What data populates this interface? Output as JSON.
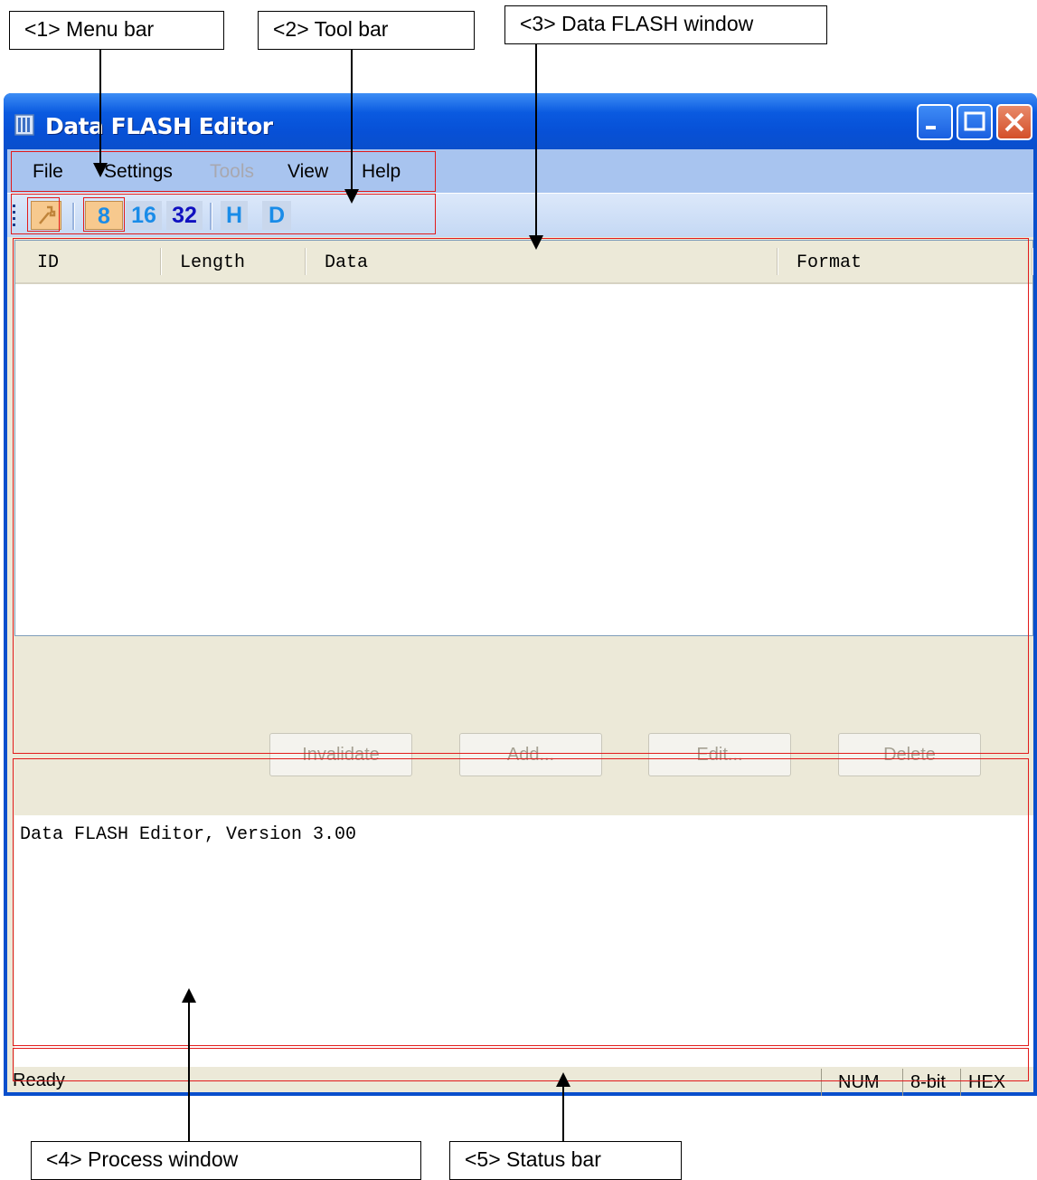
{
  "callouts": {
    "menu_bar": "<1> Menu bar",
    "tool_bar": "<2> Tool bar",
    "data_flash_window": "<3> Data FLASH window",
    "process_window": "<4> Process window",
    "status_bar": "<5> Status bar"
  },
  "window": {
    "title": "Data FLASH Editor",
    "app_icon": "app-icon"
  },
  "menu": {
    "items": [
      {
        "label": "File",
        "enabled": true
      },
      {
        "label": "Settings",
        "enabled": true
      },
      {
        "label": "Tools",
        "enabled": false
      },
      {
        "label": "View",
        "enabled": true
      },
      {
        "label": "Help",
        "enabled": true
      }
    ]
  },
  "toolbar": {
    "connect_icon": "wrench-icon",
    "bits_8": "8",
    "bits_16": "16",
    "bits_32": "32",
    "hex": "H",
    "dec": "D"
  },
  "table": {
    "columns": [
      "ID",
      "Length",
      "Data",
      "Format"
    ],
    "rows": []
  },
  "buttons": {
    "invalidate": "Invalidate",
    "add": "Add...",
    "edit": "Edit...",
    "delete": "Delete"
  },
  "process": {
    "text": "Data FLASH Editor, Version 3.00"
  },
  "status": {
    "main": "Ready",
    "num": "NUM",
    "bits": "8-bit",
    "format": "HEX"
  },
  "colors": {
    "title_bar": "#0a4fcc",
    "highlight_box": "#e21b1b",
    "tool_8": "#1a8ce8",
    "tool_16": "#1a8ce8",
    "tool_32": "#1010c0"
  }
}
